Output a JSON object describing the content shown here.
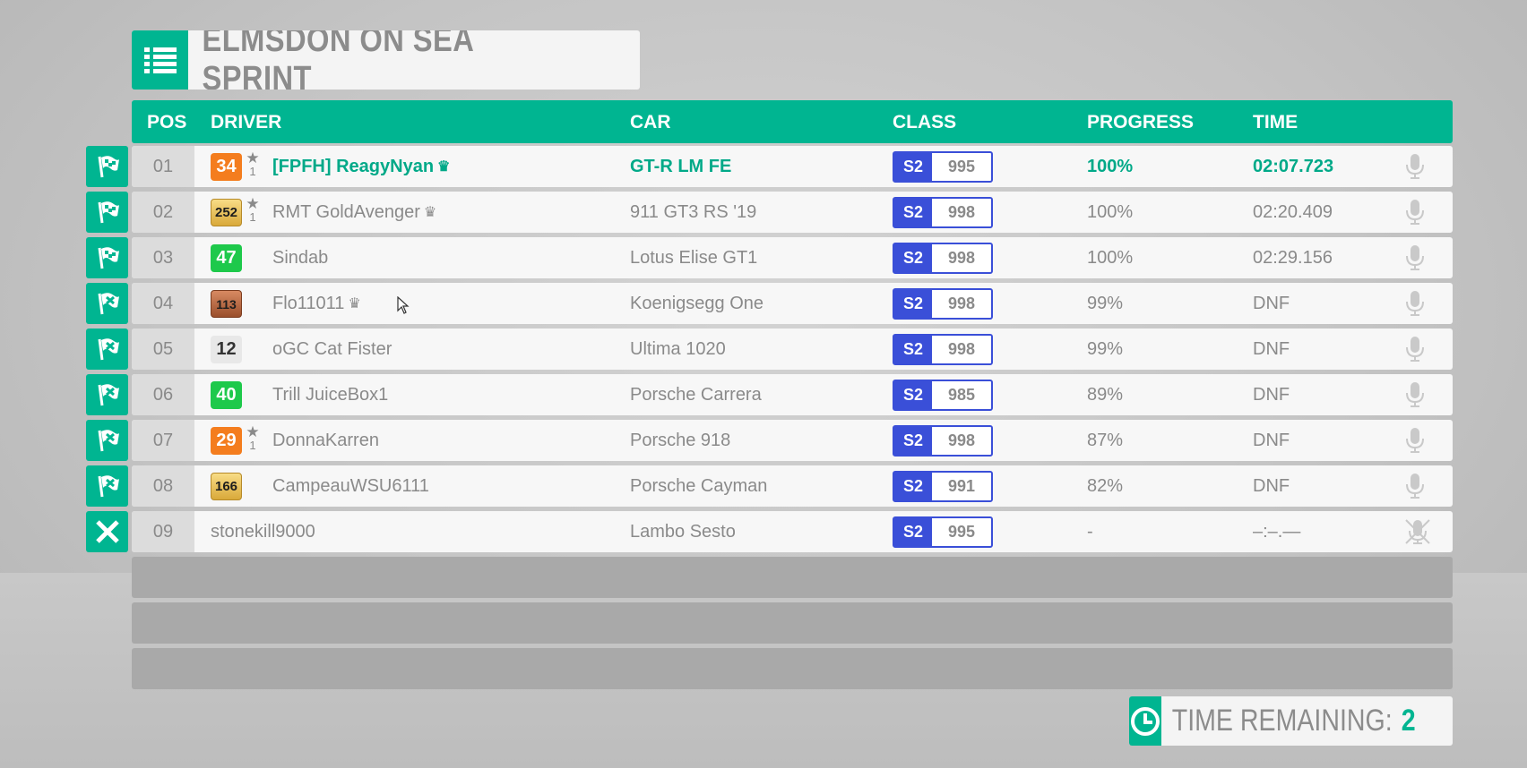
{
  "title": "ELMSDON ON SEA SPRINT",
  "columns": {
    "pos": "POS",
    "driver": "DRIVER",
    "car": "CAR",
    "class": "CLASS",
    "progress": "PROGRESS",
    "time": "TIME"
  },
  "rows": [
    {
      "status": "finished",
      "pos": "01",
      "level": "34",
      "level_style": "orange",
      "stars": "1",
      "driver": "[FPFH] ReagyNyan",
      "crown": "♛",
      "car": "GT-R LM FE",
      "class": "S2",
      "pi": "995",
      "progress": "100%",
      "time": "02:07.723",
      "highlight": true
    },
    {
      "status": "finished",
      "pos": "02",
      "level": "252",
      "level_style": "gold",
      "stars": "1",
      "driver": "RMT GoldAvenger",
      "crown": "♛",
      "car": "911 GT3 RS '19",
      "class": "S2",
      "pi": "998",
      "progress": "100%",
      "time": "02:20.409"
    },
    {
      "status": "finished",
      "pos": "03",
      "level": "47",
      "level_style": "green",
      "stars": "",
      "driver": "Sindab",
      "crown": "",
      "car": "Lotus Elise GT1",
      "class": "S2",
      "pi": "998",
      "progress": "100%",
      "time": "02:29.156"
    },
    {
      "status": "dnf",
      "pos": "04",
      "level": "113",
      "level_style": "bronze",
      "stars": "",
      "driver": "Flo11011",
      "crown": "♛",
      "car": "Koenigsegg One",
      "class": "S2",
      "pi": "998",
      "progress": "99%",
      "time": "DNF"
    },
    {
      "status": "dnf",
      "pos": "05",
      "level": "12",
      "level_style": "plain",
      "stars": "",
      "driver": "oGC Cat Fister",
      "crown": "",
      "car": "Ultima 1020",
      "class": "S2",
      "pi": "998",
      "progress": "99%",
      "time": "DNF"
    },
    {
      "status": "dnf",
      "pos": "06",
      "level": "40",
      "level_style": "green",
      "stars": "",
      "driver": "Trill JuiceBox1",
      "crown": "",
      "car": "Porsche Carrera",
      "class": "S2",
      "pi": "985",
      "progress": "89%",
      "time": "DNF"
    },
    {
      "status": "dnf",
      "pos": "07",
      "level": "29",
      "level_style": "orange",
      "stars": "1",
      "driver": "DonnaKarren",
      "crown": "",
      "car": "Porsche 918",
      "class": "S2",
      "pi": "998",
      "progress": "87%",
      "time": "DNF"
    },
    {
      "status": "dnf",
      "pos": "08",
      "level": "166",
      "level_style": "gold",
      "stars": "",
      "driver": "CampeauWSU6111",
      "crown": "",
      "car": "Porsche Cayman",
      "class": "S2",
      "pi": "991",
      "progress": "82%",
      "time": "DNF"
    },
    {
      "status": "quit",
      "pos": "09",
      "level": "",
      "level_style": "",
      "stars": "",
      "driver": "stonekill9000",
      "crown": "",
      "car": "Lambo Sesto",
      "class": "S2",
      "pi": "995",
      "progress": "-",
      "time": "–:–.—",
      "muted": true
    }
  ],
  "empty_rows": 3,
  "time_remaining": {
    "label": "TIME REMAINING:",
    "value": "2"
  },
  "colors": {
    "accent": "#00b591",
    "class_badge": "#3a4fd8"
  },
  "icons": {
    "title": "list-icon",
    "finished": "finish-flag-icon",
    "dnf": "dnf-flag-icon",
    "quit": "close-icon",
    "voice": "microphone-icon",
    "voice_muted": "microphone-muted-icon",
    "timer": "clock-icon"
  }
}
